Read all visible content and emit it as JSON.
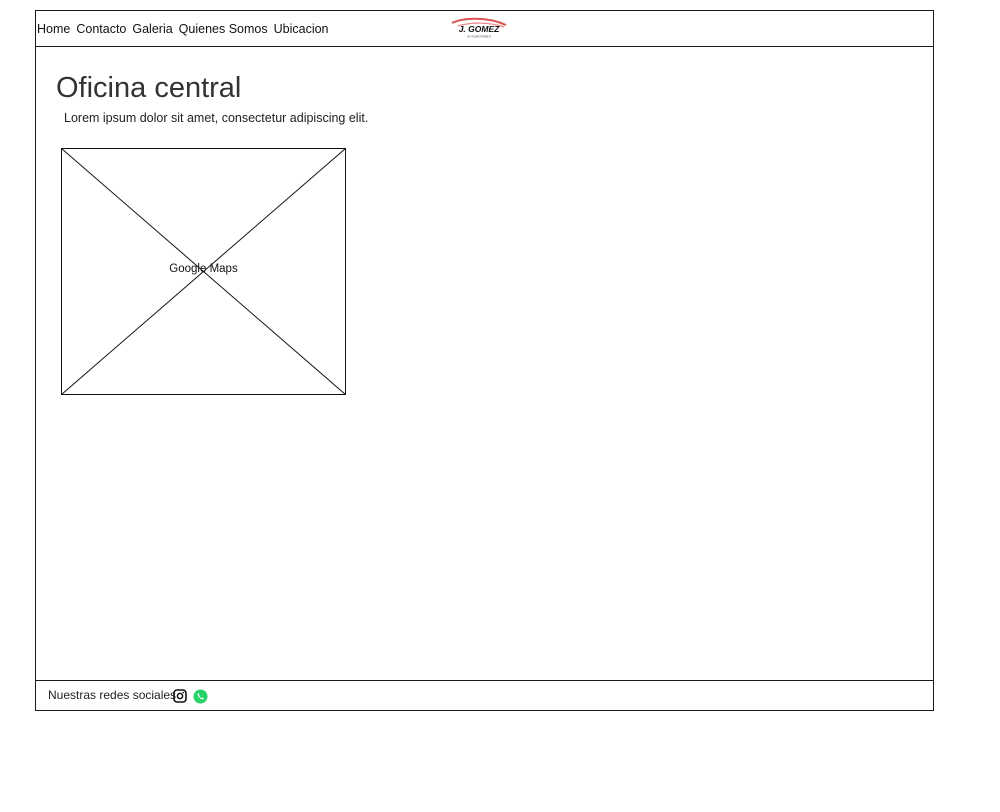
{
  "nav": {
    "items": [
      "Home",
      "Contacto",
      "Galeria",
      "Quienes Somos",
      "Ubicacion"
    ]
  },
  "logo": {
    "name": "J. GOMEZ",
    "tagline": "AUTOMOTORES",
    "accent_color": "#d9534f"
  },
  "main": {
    "title": "Oficina central",
    "description": "Lorem ipsum dolor sit amet, consectetur adipiscing elit.",
    "map_label": "Google Maps"
  },
  "footer": {
    "social_label": "Nuestras redes sociales",
    "icons": [
      "instagram-icon",
      "whatsapp-icon"
    ],
    "whatsapp_color": "#25d366"
  }
}
